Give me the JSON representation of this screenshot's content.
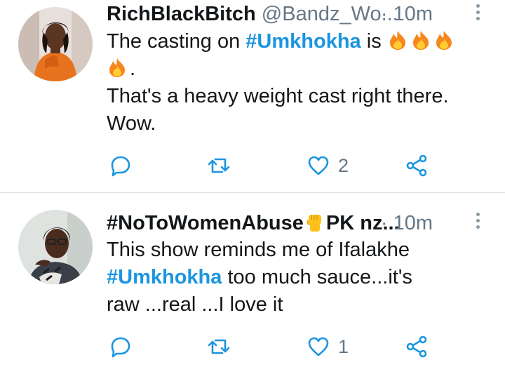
{
  "tweets": [
    {
      "name": "RichBlackBitch",
      "handle": "@Bandz_Wo...",
      "time": "· 10m",
      "text_line1_pre": "The casting on ",
      "hashtag": "#Umkhokha",
      "text_line1_post": " is ",
      "text_line2_post": ".",
      "text_line3": "That's a heavy weight cast right there.",
      "text_line4": "Wow.",
      "likes": "2",
      "emoji_icons": [
        "fire-icon",
        "fire-icon",
        "fire-icon",
        "fire-icon"
      ]
    },
    {
      "name_pre": "#NoToWomenAbuse",
      "name_post": "PK nz...",
      "time": "· 10m",
      "text_line1": "This show reminds me of Ifalakhe",
      "hashtag": "#Umkhokha",
      "text_line2_post": " too much sauce...it's",
      "text_line3": "raw ...real ...I love it",
      "likes": "1",
      "name_icon": "raised-fist-icon"
    }
  ],
  "colors": {
    "hashtag": "#1b95e0",
    "secondary_text": "#657786",
    "icon": "#1b95e0",
    "divider": "#d9dee2"
  },
  "action_icons": [
    "reply-icon",
    "retweet-icon",
    "like-icon",
    "share-icon"
  ]
}
